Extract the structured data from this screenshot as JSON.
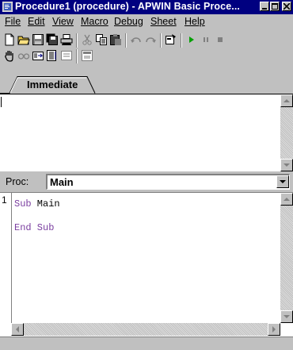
{
  "window": {
    "title": "Procedure1 (procedure) - APWIN Basic Proce..."
  },
  "menu": [
    {
      "label": "File",
      "name": "menu-file"
    },
    {
      "label": "Edit",
      "name": "menu-edit"
    },
    {
      "label": "View",
      "name": "menu-view"
    },
    {
      "label": "Macro",
      "name": "menu-macro"
    },
    {
      "label": "Debug",
      "name": "menu-debug"
    },
    {
      "label": "Sheet",
      "name": "menu-sheet"
    },
    {
      "label": "Help",
      "name": "menu-help"
    }
  ],
  "toolbar1": [
    "new-file-icon",
    "open-folder-icon",
    "save-icon",
    "save-all-icon",
    "print-icon",
    "cut-icon",
    "copy-icon",
    "paste-icon",
    "undo-icon",
    "redo-icon",
    "dialog-editor-icon",
    "run-icon",
    "pause-icon",
    "stop-icon"
  ],
  "toolbar2": [
    "hand-icon",
    "step-glasses-icon",
    "step-into-icon",
    "step-over-icon",
    "step-out-icon",
    "watch-window-icon"
  ],
  "tabs": {
    "immediate": "Immediate"
  },
  "proc": {
    "label": "Proc:",
    "value": "Main"
  },
  "code": {
    "line_number": "1",
    "lines": [
      {
        "kw": "Sub",
        "rest": " Main"
      },
      {
        "kw": "End Sub",
        "rest": ""
      }
    ]
  },
  "colors": {
    "title_bar": "#000080",
    "keyword": "#7b3fa0",
    "face": "#c0c0c0"
  }
}
